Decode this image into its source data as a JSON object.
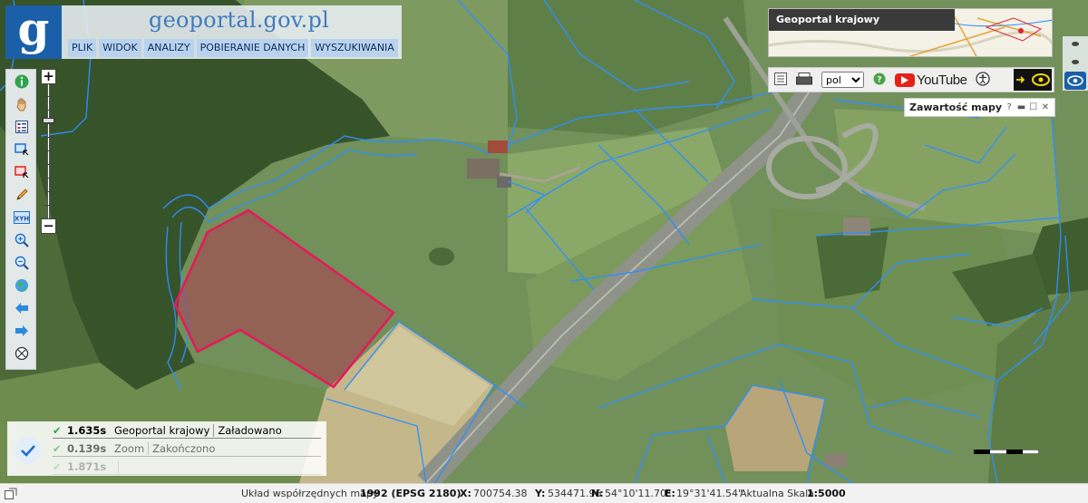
{
  "header": {
    "logo_letter": "g",
    "site_title": "geoportal.gov.pl",
    "menu": [
      "PLIK",
      "WIDOK",
      "ANALIZY",
      "POBIERANIE DANYCH",
      "WYSZUKIWANIA"
    ]
  },
  "toolbar": {
    "items": [
      "info-icon",
      "pan-hand-icon",
      "legend-icon",
      "select-rect-icon",
      "select-rect-red-icon",
      "draw-pencil-icon",
      "xyh-coordinates-icon",
      "zoom-in-icon",
      "zoom-out-icon",
      "full-extent-globe-icon",
      "back-arrow-icon",
      "forward-arrow-icon",
      "compass-icon"
    ],
    "xyh_label": "XYH",
    "zoom_in": "+",
    "zoom_out": "−",
    "zoom_level": 0.27
  },
  "overview": {
    "label": "Geoportal krajowy"
  },
  "toolset": {
    "lang_options": [
      "pol"
    ],
    "lang_selected": "pol",
    "youtube_label": "YouTube"
  },
  "panel": {
    "title": "Zawartość mapy",
    "help": "?"
  },
  "log": {
    "rows": [
      {
        "time": "1.635s",
        "source": "Geoportal krajowy",
        "status": "Załadowano"
      },
      {
        "time": "0.139s",
        "source": "Zoom",
        "status": "Zakończono"
      },
      {
        "time": "1.871s",
        "source": "",
        "status": ""
      }
    ]
  },
  "statusbar": {
    "crs_label": "Układ współrzędnych mapy",
    "crs_value": "1992 (EPSG 2180)",
    "x_label": "X:",
    "x_value": "700754.38",
    "y_label": "Y:",
    "y_value": "534471.96",
    "n_label": "N:",
    "n_value": "54°10'11.70\"",
    "e_label": "E:",
    "e_value": "19°31'41.54\"",
    "scale_label": "Aktualna Skala",
    "scale_value": "1:5000"
  },
  "colors": {
    "parcel_lines": "#2f8fff",
    "selection": "#e6195a",
    "menu_bg": "#b9d3ee",
    "logo_bg": "#1b5fa8"
  }
}
